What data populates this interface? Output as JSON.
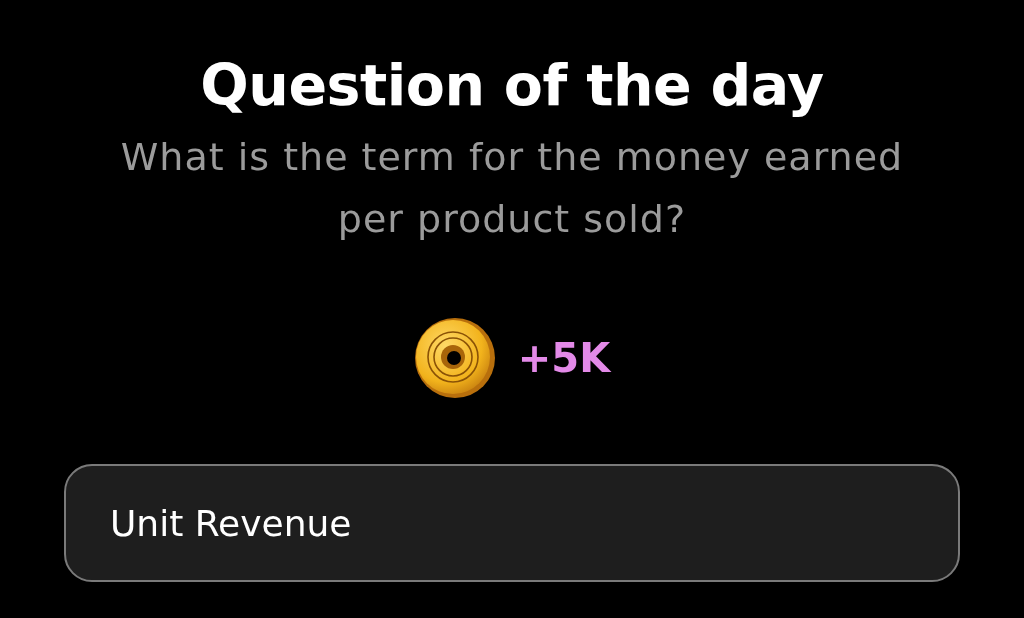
{
  "title": "Question of the day",
  "question": "What is the term for the money earned per product sold?",
  "reward": {
    "amount": "+5K"
  },
  "answer": {
    "value": "Unit Revenue"
  }
}
